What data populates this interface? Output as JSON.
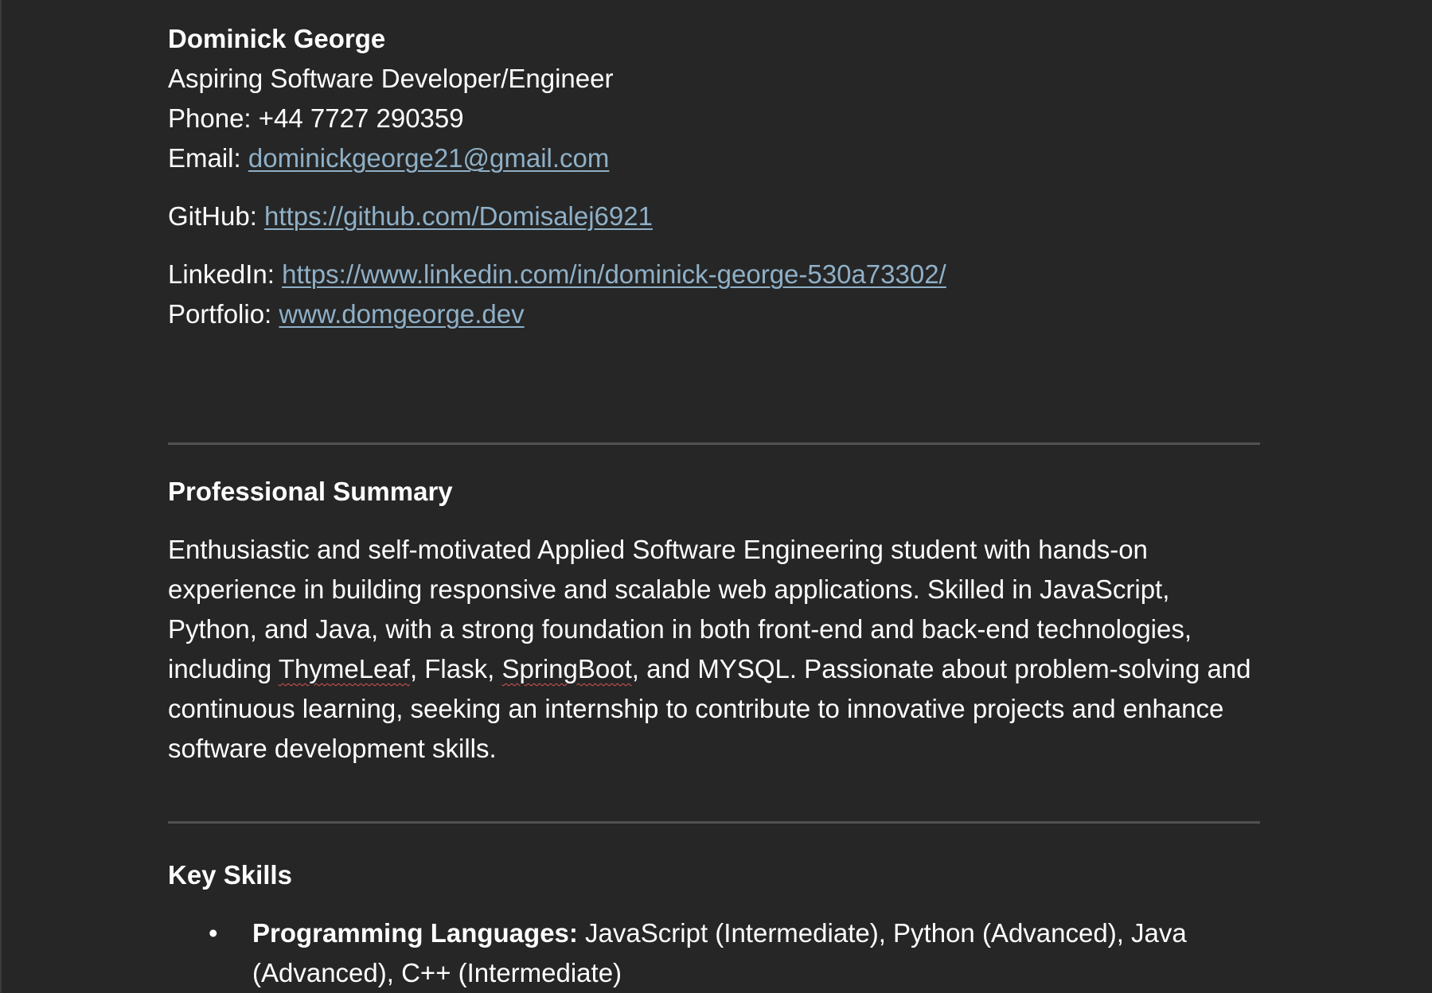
{
  "contact": {
    "name": "Dominick George",
    "title": "Aspiring Software Developer/Engineer",
    "phone_label": "Phone: ",
    "phone": "+44 7727 290359",
    "email_label": "Email: ",
    "email": "dominickgeorge21@gmail.com",
    "github_label": "GitHub: ",
    "github": "https://github.com/Domisalej6921",
    "linkedin_label": "LinkedIn: ",
    "linkedin": "https://www.linkedin.com/in/dominick-george-530a73302/",
    "portfolio_label": "Portfolio: ",
    "portfolio": "www.domgeorge.dev"
  },
  "summary": {
    "heading": "Professional Summary",
    "text_1": "Enthusiastic and self-motivated Applied Software Engineering student with hands-on experience in building responsive and scalable web applications. Skilled in JavaScript, Python, and Java, with a strong foundation in both front-end and back-end technologies, including ",
    "term_1": "ThymeLeaf",
    "text_2": ", Flask, ",
    "term_2": "SpringBoot",
    "text_3": ", and MYSQL. Passionate about problem-solving and continuous learning, seeking an internship to contribute to innovative projects and enhance software development skills."
  },
  "skills": {
    "heading": "Key Skills",
    "bullet": "•",
    "items": [
      {
        "label": "Programming Languages:",
        "text": " JavaScript (Intermediate), Python (Advanced), Java (Advanced), C++ (Intermediate)"
      }
    ]
  },
  "colors": {
    "background": "#262626",
    "text": "#ffffff",
    "link": "#8fb0c7",
    "rule": "#4d4d4d",
    "spellcheck": "#d9534f"
  }
}
